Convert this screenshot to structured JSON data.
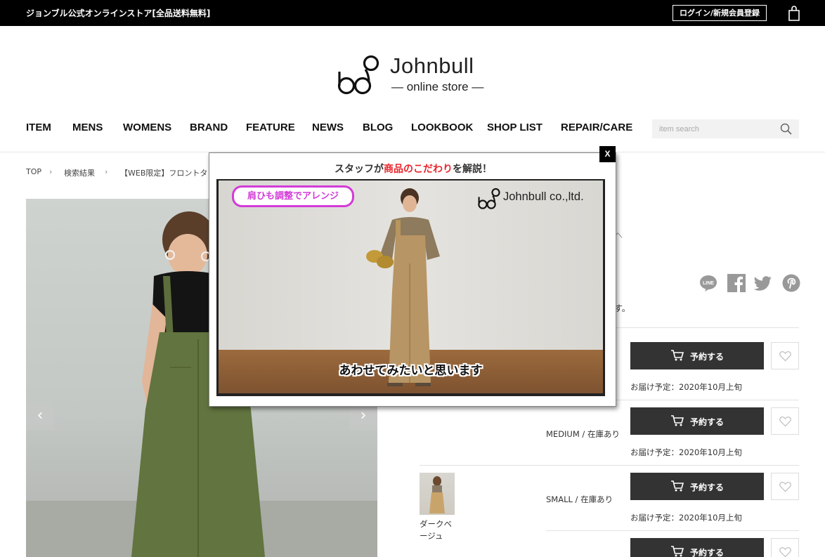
{
  "topbar": {
    "store_name": "ジョンブル公式オンラインストア[全品送料無料]",
    "login_label": "ログイン/新規会員登録",
    "cart_icon": "shopping-bag-icon"
  },
  "logo": {
    "name": "Johnbull",
    "sub": "— online store —"
  },
  "nav": {
    "items": [
      "ITEM",
      "MENS",
      "WOMENS",
      "BRAND",
      "FEATURE",
      "NEWS",
      "BLOG",
      "LOOKBOOK",
      "SHOP LIST",
      "REPAIR/CARE"
    ],
    "search_placeholder": "item search"
  },
  "breadcrumb": {
    "items": [
      "TOP",
      "検索結果",
      "【WEB限定】フロントタッ"
    ]
  },
  "product": {
    "prev_arrow": "‹",
    "next_arrow": "›",
    "partial_text_1": "ヘ",
    "partial_text_2": "す。"
  },
  "variants": [
    {
      "size": "",
      "delivery": "お届け予定：2020年10月上旬"
    },
    {
      "size": "MEDIUM / 在庫あり",
      "delivery": "お届け予定：2020年10月上旬"
    },
    {
      "size": "SMALL / 在庫あり",
      "delivery": "お届け予定：2020年10月上旬"
    }
  ],
  "reserve_label": "予約する",
  "color_name": "ダークベージュ",
  "popup": {
    "close_label": "X",
    "title_pre": "スタッフが",
    "title_highlight": "商品のこだわり",
    "title_post": "を解説！",
    "video_tag": "肩ひも調整でアレンジ",
    "video_logo": "Johnbull co.,ltd.",
    "caption": "あわせてみたいと思います"
  },
  "colors": {
    "accent_red": "#e8242b",
    "tag_magenta": "#d33bd8",
    "button_dark": "#333333"
  }
}
